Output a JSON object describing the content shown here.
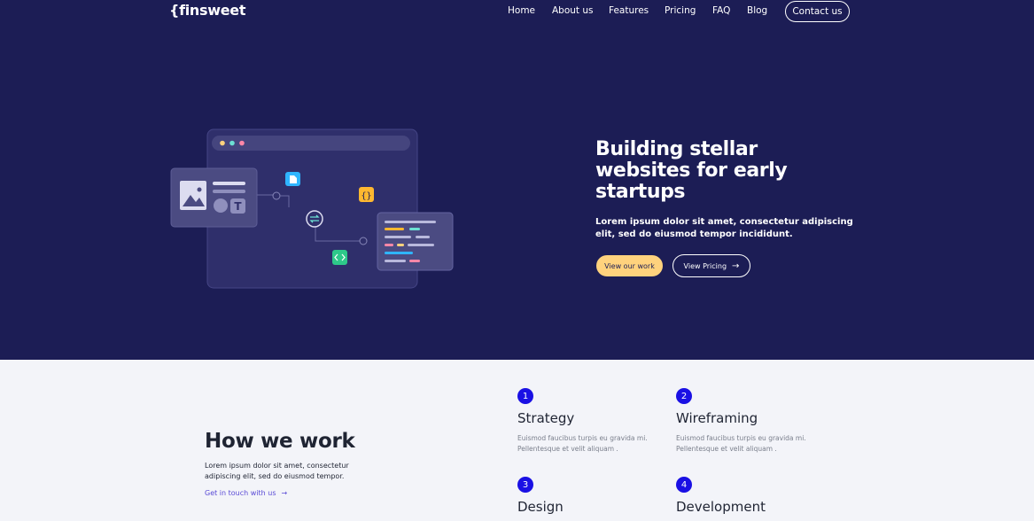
{
  "header": {
    "logo": "{finsweet",
    "nav": [
      "Home",
      "About us",
      "Features",
      "Pricing",
      "FAQ",
      "Blog"
    ],
    "contact_label": "Contact us"
  },
  "hero": {
    "title": "Building stellar websites for early startups",
    "description": "Lorem ipsum dolor sit amet, consectetur adipiscing elit, sed do eiusmod tempor incididunt.",
    "primary_button": "View our work",
    "secondary_button": "View Pricing",
    "arrow": "→",
    "colors": {
      "background": "#1c1d55",
      "accent": "#ffd27d"
    }
  },
  "how": {
    "title": "How we work",
    "description": "Lorem ipsum dolor sit amet, consectetur adipiscing elit, sed do eiusmod tempor.",
    "link": "Get in touch with us",
    "arrow": "→",
    "steps": [
      {
        "num": "1",
        "title": "Strategy",
        "desc": "Euismod faucibus turpis eu gravida mi. Pellentesque et velit aliquam ."
      },
      {
        "num": "2",
        "title": "Wireframing",
        "desc": "Euismod faucibus turpis eu gravida mi. Pellentesque et velit aliquam ."
      },
      {
        "num": "3",
        "title": "Design",
        "desc": ""
      },
      {
        "num": "4",
        "title": "Development",
        "desc": ""
      }
    ],
    "colors": {
      "step_badge": "#1a10e4",
      "link": "#5a4bd6"
    }
  }
}
